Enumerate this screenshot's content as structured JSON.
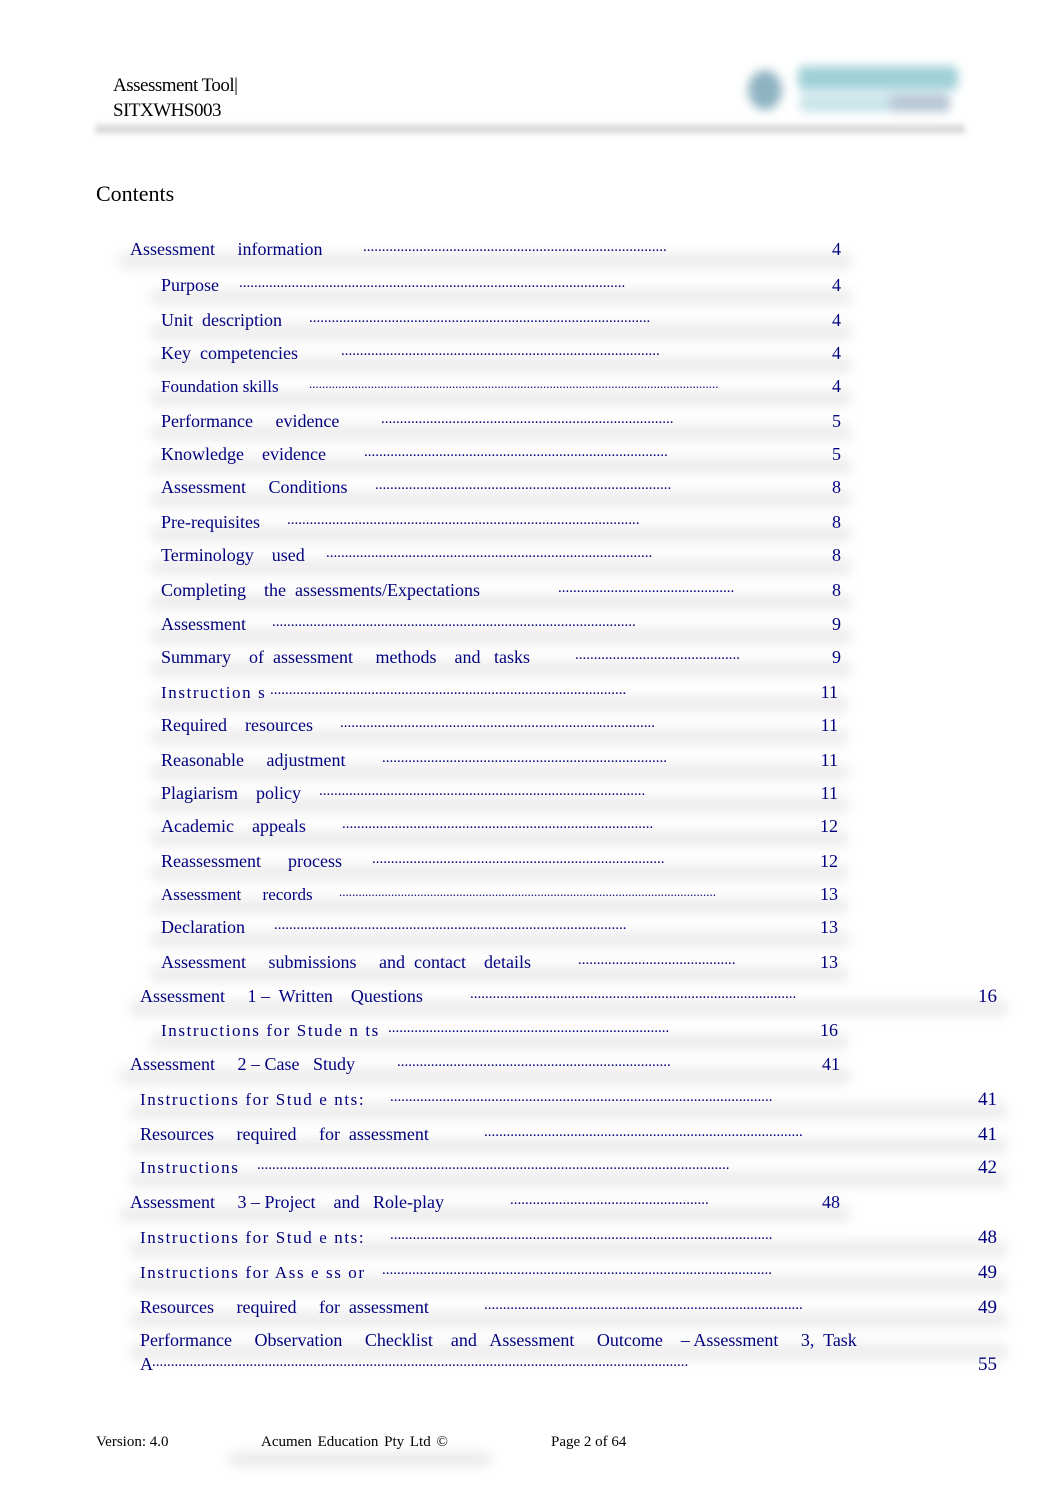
{
  "header": {
    "title_line1": "Assessment Tool|",
    "title_line2": "SITXWHS003",
    "logo_icon": "company-logo"
  },
  "contents_title": "Contents",
  "toc": [
    {
      "label": "Assessment     information",
      "page": "4",
      "level": 1
    },
    {
      "label": "Purpose",
      "page": "4",
      "level": 2
    },
    {
      "label": "Unit  description",
      "page": "4",
      "level": 2
    },
    {
      "label": "Key  competencies",
      "page": "4",
      "level": 2
    },
    {
      "label": "Foundation skills",
      "page": "4",
      "level": 2
    },
    {
      "label": "Performance     evidence",
      "page": "5",
      "level": 2
    },
    {
      "label": "Knowledge    evidence",
      "page": "5",
      "level": 2
    },
    {
      "label": "Assessment     Conditions",
      "page": "8",
      "level": 2
    },
    {
      "label": "Pre-requisites",
      "page": "8",
      "level": 2
    },
    {
      "label": "Terminology    used",
      "page": "8",
      "level": 2
    },
    {
      "label": "Completing    the  assessments/Expectations",
      "page": "8",
      "level": 2
    },
    {
      "label": "Assessment",
      "page": "9",
      "level": 2
    },
    {
      "label": "Summary    of  assessment     methods    and   tasks",
      "page": "9",
      "level": 2
    },
    {
      "label": "Instruction s",
      "page": "11",
      "level": 2
    },
    {
      "label": "Required    resources",
      "page": "11",
      "level": 2
    },
    {
      "label": "Reasonable     adjustment",
      "page": "11",
      "level": 2
    },
    {
      "label": "Plagiarism    policy",
      "page": "11",
      "level": 2
    },
    {
      "label": "Academic    appeals",
      "page": "12",
      "level": 2
    },
    {
      "label": "Reassessment      process",
      "page": "12",
      "level": 2
    },
    {
      "label": "Assessment     records",
      "page": "13",
      "level": 2
    },
    {
      "label": "Declaration",
      "page": "13",
      "level": 2
    },
    {
      "label": "Assessment     submissions     and  contact    details",
      "page": "13",
      "level": 2
    },
    {
      "label": "Assessment     1 –  Written    Questions",
      "page": "16",
      "level": 1
    },
    {
      "label": "Instructions for Stude n ts",
      "page": "16",
      "level": 2
    },
    {
      "label": "Assessment     2 – Case   Study",
      "page": "41",
      "level": 1
    },
    {
      "label": "Instructions for Stud e nts:",
      "page": "41",
      "level": 2
    },
    {
      "label": "Resources     required     for  assessment",
      "page": "41",
      "level": 2
    },
    {
      "label": "Instructions",
      "page": "42",
      "level": 2
    },
    {
      "label": "Assessment     3 – Project    and   Role-play",
      "page": "48",
      "level": 1
    },
    {
      "label": "Instructions for Stud e nts:",
      "page": "48",
      "level": 2
    },
    {
      "label": "Instructions for Ass e ss or",
      "page": "49",
      "level": 2
    },
    {
      "label": "Resources     required     for  assessment",
      "page": "49",
      "level": 2
    },
    {
      "label": "Performance     Observation     Checklist    and   Assessment     Outcome    – Assessment     3,  Task",
      "continuation": "A",
      "page": "55",
      "level": 2
    }
  ],
  "footer": {
    "version": "Version: 4.0",
    "company": "Acumen    Education Pty     Ltd  ©",
    "page": "Page 2    of  64"
  }
}
